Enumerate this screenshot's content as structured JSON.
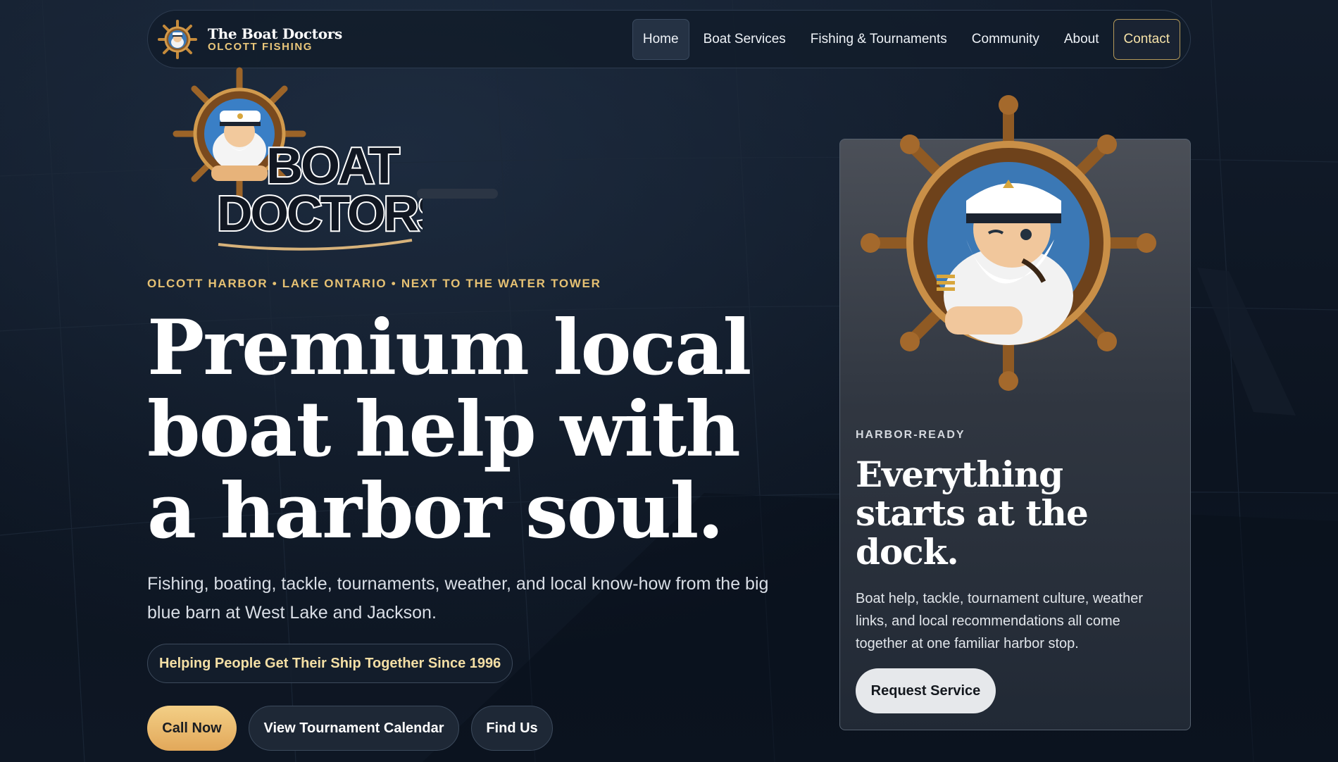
{
  "nav": {
    "brand_title": "The Boat Doctors",
    "brand_subtitle": "OLCOTT FISHING",
    "items": [
      {
        "label": "Home"
      },
      {
        "label": "Boat Services"
      },
      {
        "label": "Fishing & Tournaments"
      },
      {
        "label": "Community"
      },
      {
        "label": "About"
      },
      {
        "label": "Contact"
      }
    ],
    "active": "Home"
  },
  "hero": {
    "logo_text_line1": "BOAT",
    "logo_text_line2": "DOCTORS",
    "eyebrow": "OLCOTT HARBOR • LAKE ONTARIO • NEXT TO THE WATER TOWER",
    "headline": "Premium local boat help with a harbor soul.",
    "lede": "Fishing, boating, tackle, tournaments, weather, and local know-how from the big blue barn at West Lake and Jackson.",
    "pill": "Helping People Get Their Ship Together Since 1996",
    "buttons": {
      "call": "Call Now",
      "tournament": "View Tournament Calendar",
      "find": "Find Us"
    }
  },
  "card": {
    "eyebrow": "HARBOR-READY",
    "title": "Everything starts at the dock.",
    "text": "Boat help, tackle, tournament culture, weather links, and local recommendations all come together at one familiar harbor stop.",
    "button": "Request Service"
  },
  "colors": {
    "background": "#0d1522",
    "accent_gold": "#e6c173",
    "call_button": "#f3cf86",
    "text": "#ffffff"
  },
  "icons": {
    "brand_logo": "captain-wheel-icon",
    "mascot": "captain-mascot-wheel"
  }
}
